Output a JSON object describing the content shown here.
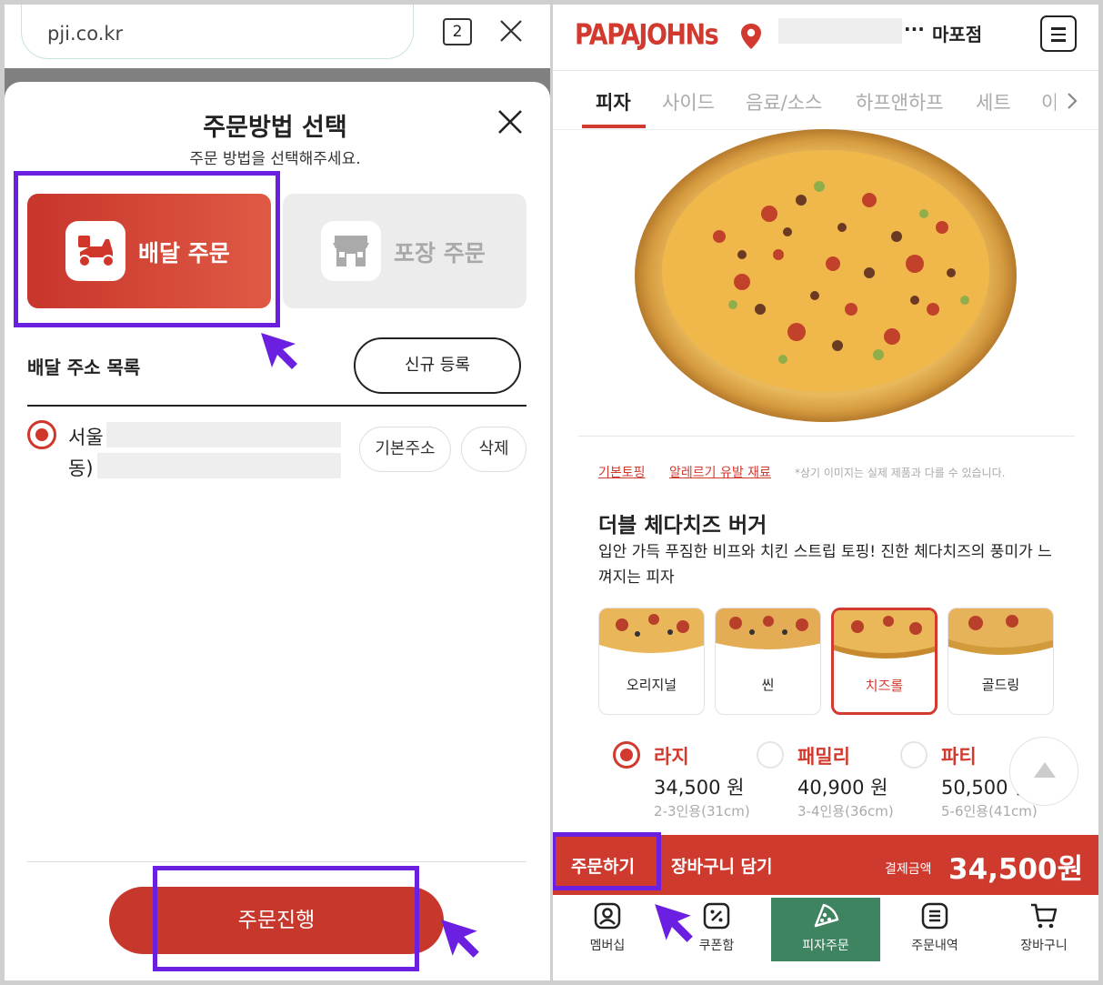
{
  "left_panel": {
    "browser": {
      "url": "pji.co.kr",
      "tab_count": "2"
    },
    "sheet": {
      "title": "주문방법 선택",
      "subtitle": "주문 방법을 선택해주세요.",
      "delivery_label": "배달 주문",
      "takeout_label": "포장 주문",
      "address_section_title": "배달 주소 목록",
      "new_address_button": "신규 등록",
      "address_line1": "서울",
      "address_line2": "동)",
      "default_address_button": "기본주소",
      "delete_button": "삭제",
      "proceed_button": "주문진행"
    }
  },
  "right_panel": {
    "brand": "PAPAJOHNs",
    "header": {
      "dots": "···",
      "store": "마포점"
    },
    "tabs": [
      "피자",
      "사이드",
      "음료/소스",
      "하프앤하프",
      "세트",
      "이"
    ],
    "links": {
      "basic_topping": "기본토핑",
      "allergy": "알레르기 유발 재료"
    },
    "notice": "*상기 이미지는 실제 제품과 다를 수 있습니다.",
    "product": {
      "name": "더블 체다치즈 버거",
      "description": "입안 가득 푸짐한 비프와 치킨 스트립 토핑! 진한 체다치즈의 풍미가 느껴지는 피자"
    },
    "doughs": [
      "오리지널",
      "씬",
      "치즈롤",
      "골드링"
    ],
    "selected_dough": "치즈롤",
    "sizes": [
      {
        "name": "라지",
        "price": "34,500 원",
        "note": "2-3인용(31cm)",
        "selected": true
      },
      {
        "name": "패밀리",
        "price": "40,900 원",
        "note": "3-4인용(36cm)",
        "selected": false
      },
      {
        "name": "파티",
        "price": "50,500 원",
        "note": "5-6인용(41cm)",
        "selected": false
      }
    ],
    "order_bar": {
      "order_button": "주문하기",
      "cart_button": "장바구니 담기",
      "pay_label": "결제금액",
      "pay_amount": "34,500원"
    },
    "bottom_nav": [
      "멤버십",
      "쿠폰함",
      "피자주문",
      "주문내역",
      "장바구니"
    ]
  },
  "colors": {
    "brand_red": "#d23a2f",
    "highlight_purple": "#6b1fe0",
    "nav_green": "#3e8460"
  }
}
